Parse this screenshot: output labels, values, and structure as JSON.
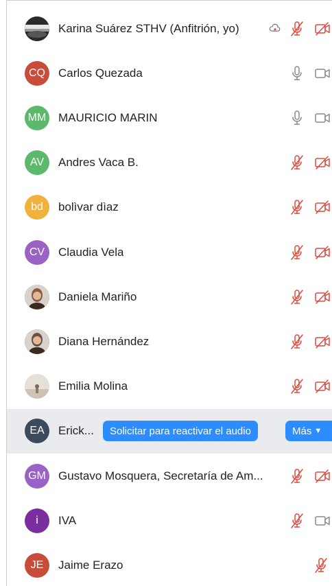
{
  "participants": [
    {
      "name": "Karina Suárez STHV (Anfitrión, yo)",
      "initials": "",
      "avatar_color": "#555555",
      "avatar_kind": "photo-landscape",
      "mic": "muted",
      "video": "off",
      "extra": "cloud"
    },
    {
      "name": "Carlos Quezada",
      "initials": "CQ",
      "avatar_color": "#c94c3a",
      "mic": "on",
      "video": "on"
    },
    {
      "name": "MAURICIO MARIN",
      "initials": "MM",
      "avatar_color": "#5cb86a",
      "mic": "on",
      "video": "on"
    },
    {
      "name": "Andres Vaca B.",
      "initials": "AV",
      "avatar_color": "#5cb86a",
      "mic": "muted",
      "video": "off"
    },
    {
      "name": "bolìvar dìaz",
      "initials": "bd",
      "avatar_color": "#f0b23d",
      "mic": "muted",
      "video": "off"
    },
    {
      "name": "Claudia Vela",
      "initials": "CV",
      "avatar_color": "#9a62c4",
      "mic": "muted",
      "video": "off"
    },
    {
      "name": "Daniela Mariño",
      "initials": "",
      "avatar_color": "#8a5a40",
      "avatar_kind": "photo-person",
      "mic": "muted",
      "video": "off"
    },
    {
      "name": "Diana Hernández",
      "initials": "",
      "avatar_color": "#6a5040",
      "avatar_kind": "photo-person",
      "mic": "muted",
      "video": "off"
    },
    {
      "name": "Emilia Molina",
      "initials": "",
      "avatar_color": "#d8d0c8",
      "avatar_kind": "photo-light",
      "mic": "muted",
      "video": "off"
    },
    {
      "name": "Erick...",
      "initials": "EA",
      "avatar_color": "#3d4a5c",
      "highlight": true,
      "request_label": "Solicitar para reactivar el audio",
      "more_label": "Más"
    },
    {
      "name": "Gustavo Mosquera, Secretaría de Am...",
      "initials": "GM",
      "avatar_color": "#9a62c4",
      "mic": "muted",
      "video": "off"
    },
    {
      "name": "IVA",
      "initials": "i",
      "avatar_color": "#7a2ea0",
      "mic": "muted",
      "video": "on"
    },
    {
      "name": "Jaime Erazo",
      "initials": "JE",
      "avatar_color": "#c94c3a",
      "mic": "muted",
      "video": "none"
    }
  ],
  "colors": {
    "muted_red": "#e0483c",
    "icon_gray": "#8a8a8a",
    "accent_blue": "#2d8cff"
  }
}
